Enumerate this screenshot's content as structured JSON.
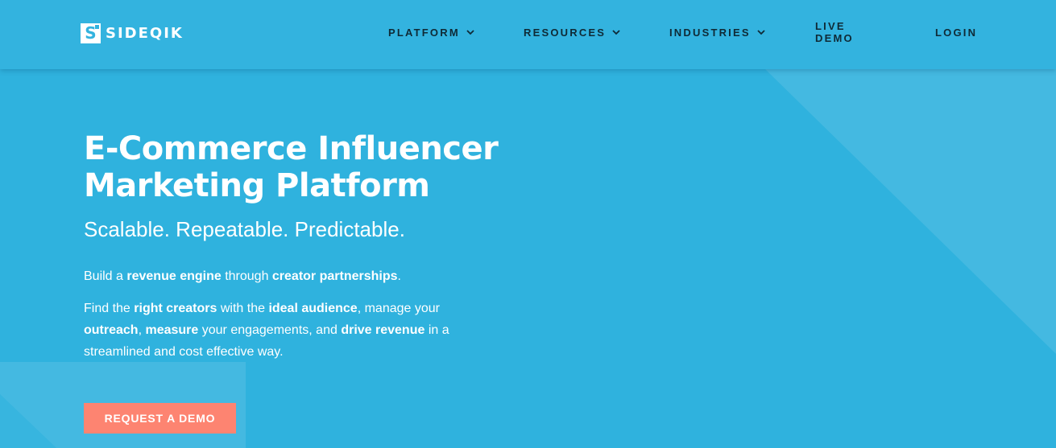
{
  "brand": {
    "name": "SIDEQIK",
    "mark": "S"
  },
  "nav": {
    "platform": "PLATFORM",
    "resources": "RESOURCES",
    "industries": "INDUSTRIES",
    "live_demo": "LIVE DEMO",
    "login": "LOGIN"
  },
  "hero": {
    "title_line1": "E-Commerce Influencer",
    "title_line2": "Marketing Platform",
    "tagline": "Scalable. Repeatable. Predictable.",
    "intro": {
      "t1": "Build a ",
      "b1": "revenue engine",
      "t2": " through ",
      "b2": "creator partnerships",
      "t3": "."
    },
    "detail": {
      "t1": "Find the ",
      "b1": "right creators",
      "t2": " with the ",
      "b2": "ideal audience",
      "t3": ", manage your ",
      "b3": "outreach",
      "t4": ", ",
      "b4": "measure",
      "t5": " your engagements, and ",
      "b5": "drive revenue",
      "t6": " in a streamlined and cost effective way."
    },
    "cta": "REQUEST A DEMO"
  },
  "icons": {
    "dropdown": "chevron-down-icon"
  },
  "colors": {
    "background": "#2fb2de",
    "header": "#33b3df",
    "nav_text": "#0f2a36",
    "cta": "#fd8471"
  }
}
